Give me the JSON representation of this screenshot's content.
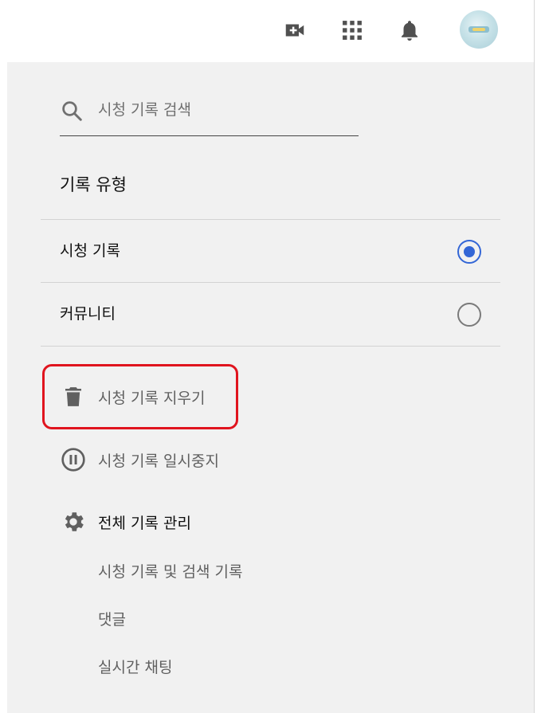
{
  "header": {
    "create_icon": "video-camera-plus-icon",
    "apps_icon": "grid-apps-icon",
    "notifications_icon": "bell-icon",
    "avatar": "user-avatar"
  },
  "search": {
    "placeholder": "시청 기록 검색",
    "value": ""
  },
  "history_type": {
    "title": "기록 유형",
    "options": [
      {
        "label": "시청 기록",
        "selected": true
      },
      {
        "label": "커뮤니티",
        "selected": false
      }
    ]
  },
  "actions": {
    "clear": "시청 기록 지우기",
    "pause": "시청 기록 일시중지",
    "manage": "전체 기록 관리"
  },
  "manage_links": [
    "시청 기록 및 검색 기록",
    "댓글",
    "실시간 채팅"
  ],
  "colors": {
    "panel_bg": "#f1f1f1",
    "radio_selected": "#3366d6",
    "highlight_border": "#e0141e"
  }
}
